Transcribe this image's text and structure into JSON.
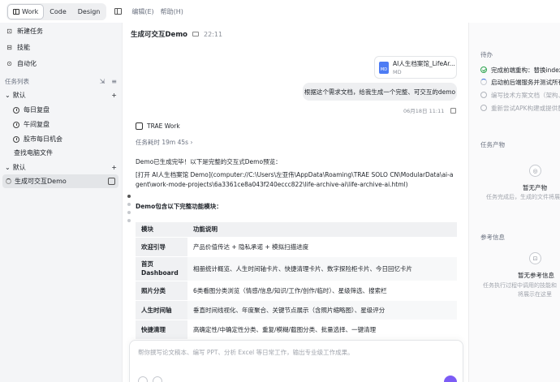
{
  "topbar": {
    "modes": [
      {
        "label": "Work",
        "active": true
      },
      {
        "label": "Code",
        "active": false
      },
      {
        "label": "Design",
        "active": false
      }
    ],
    "menus": [
      "编辑(E)",
      "帮助(H)"
    ]
  },
  "sidebar": {
    "actions": [
      {
        "label": "新建任务",
        "icon": "new-task-icon"
      },
      {
        "label": "技能",
        "icon": "skill-icon"
      },
      {
        "label": "自动化",
        "icon": "automation-icon"
      }
    ],
    "task_list_title": "任务列表",
    "groups": [
      {
        "label": "默认",
        "items": [
          "每日复盘",
          "午间复盘",
          "股市每日机会"
        ]
      },
      {
        "label": "默认",
        "items": []
      }
    ],
    "find_files": "查找电脑文件",
    "active_task": "生成可交互Demo"
  },
  "conversation": {
    "title": "生成可交互Demo",
    "time": "22:11",
    "attachment": {
      "name": "AI人生档案馆_LifeAr...",
      "type": "MD"
    },
    "user_message": "根据这个需求文档，给我生成一个完整、可交互的demo",
    "message_time": "06月18日 11:11",
    "agent_name": "TRAE Work",
    "duration": "任务耗时 19m 45s",
    "result_intro": "Demo已生成完毕！以下是完整的交互式Demo预览：",
    "result_link": "[打开 AI人生档案馆 Demo](computer://C:\\Users\\左亚伟\\AppData\\Roaming\\TRAE SOLO CN\\ModularData\\ai-agent\\work-mode-projects\\6a3361ce8a043f240eccc822\\life-archive-ai\\life-archive-ai.html)",
    "modules_title": "Demo包含以下完整功能模块：",
    "table": {
      "headers": [
        "模块",
        "功能说明"
      ],
      "rows": [
        {
          "name": "欢迎引导",
          "desc": "产品价值传达 + 隐私承诺 + 模拟扫描进度"
        },
        {
          "name": "首页 Dashboard",
          "desc": "相册统计概览、人生时间轴卡片、快捷清理卡片、数字探险柜卡片、今日回忆卡片"
        },
        {
          "name": "照片分类",
          "desc": "6类看图分类浏览（情感/信息/知识/工作/创作/临时）、星级筛选、搜索栏"
        },
        {
          "name": "人生时间轴",
          "desc": "垂直时间线视化、年度聚合、关键节点展示（含照片缩略图）、星级评分"
        },
        {
          "name": "快捷清理",
          "desc": "高确定性/中确定性分类、重复/模糊/截图分类、批量选择、一键清理"
        }
      ]
    },
    "composer_placeholder": "帮你撰写论文稿本、编写 PPT、分析 Excel 等日常工作，输出专业级工作成果。"
  },
  "right_panel": {
    "todo_title": "待办",
    "todos": [
      {
        "text": "完成前端重构：替换index.ht",
        "status": "done"
      },
      {
        "text": "启动前后端服务并测试所有API",
        "status": "running"
      },
      {
        "text": "编写技术方案文档（架构、API",
        "status": "pending"
      },
      {
        "text": "重新尝试APK构建或提供替代方",
        "status": "pending"
      }
    ],
    "artifacts_title": "任务产物",
    "artifacts_empty_title": "暂无产物",
    "artifacts_empty_desc": "任务完成后，生成的文件将展示在",
    "refs_title": "参考信息",
    "refs_empty_title": "暂无参考信息",
    "refs_empty_desc": [
      "任务执行过程中调用的技能和",
      "将展示在这里"
    ]
  },
  "colors": {
    "send_button": "#7c5cf5",
    "done": "#2da44e",
    "running": "#3b6fe0"
  }
}
